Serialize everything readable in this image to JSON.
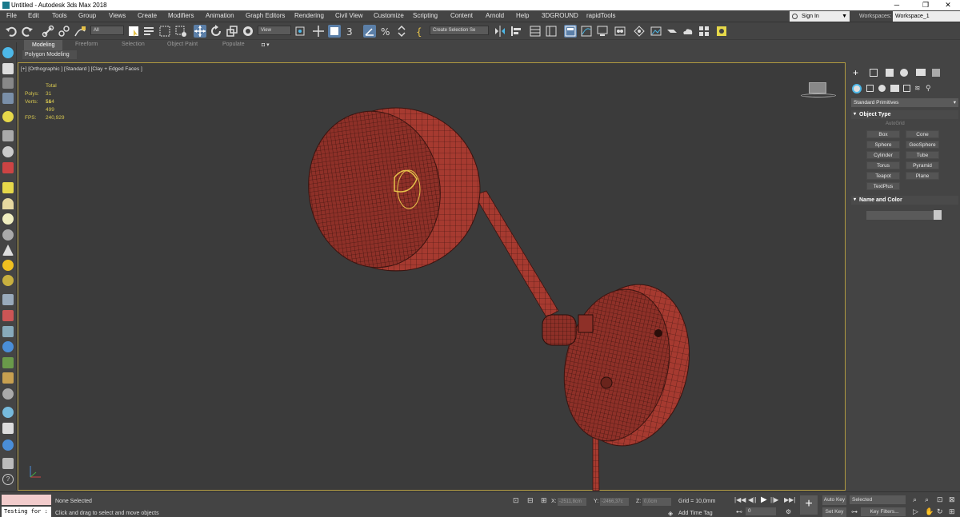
{
  "window": {
    "title": "Untitled - Autodesk 3ds Max 2018",
    "icon": "app-icon",
    "controls": [
      "─",
      "❐",
      "✕"
    ]
  },
  "menu": [
    "File",
    "Edit",
    "Tools",
    "Group",
    "Views",
    "Create",
    "Modifiers",
    "Animation",
    "Graph Editors",
    "Rendering",
    "Civil View",
    "Customize",
    "Scripting",
    "Content",
    "Arnold",
    "Help",
    "3DGROUND",
    "rapidTools"
  ],
  "account": {
    "signin": "Sign In",
    "workspaces_label": "Workspaces:",
    "workspace": "Workspace_1"
  },
  "toolbar": {
    "selection_filter": "All",
    "ref_coord": "View",
    "selection_set": "Create Selection Se"
  },
  "ribbon": {
    "tabs": [
      "Modeling",
      "Freeform",
      "Selection",
      "Object Paint",
      "Populate"
    ],
    "active": "Modeling",
    "panel": "Polygon Modeling"
  },
  "viewport": {
    "label": "[+] [Orthographic ] [Standard ] [Clay + Edged Faces ]",
    "stats": {
      "total_label": "Total",
      "polys_label": "Polys:",
      "polys": "31 514",
      "verts_label": "Verts:",
      "verts": "16 499",
      "fps_label": "FPS:",
      "fps": "240,929"
    },
    "model_color": "#a63a30",
    "border_color": "#b09a40"
  },
  "command_panel": {
    "category": "Standard Primitives",
    "object_type_title": "Object Type",
    "autogrid": "AutoGrid",
    "primitives": [
      "Box",
      "Cone",
      "Sphere",
      "GeoSphere",
      "Cylinder",
      "Tube",
      "Torus",
      "Pyramid",
      "Teapot",
      "Plane",
      "TextPlus"
    ],
    "name_color_title": "Name and Color"
  },
  "status": {
    "selected": "None Selected",
    "prompt": "Click and drag to select and move objects",
    "script": "Testing for :",
    "x_label": "X:",
    "x": "-2511,8cm",
    "y_label": "Y:",
    "y": "-2466,37c",
    "z_label": "Z:",
    "z": "0,0cm",
    "grid": "Grid = 10,0mm",
    "add_time_tag": "Add Time Tag",
    "frame": "0",
    "auto_key": "Auto Key",
    "set_key": "Set Key",
    "selected_dd": "Selected",
    "key_filters": "Key Filters..."
  }
}
